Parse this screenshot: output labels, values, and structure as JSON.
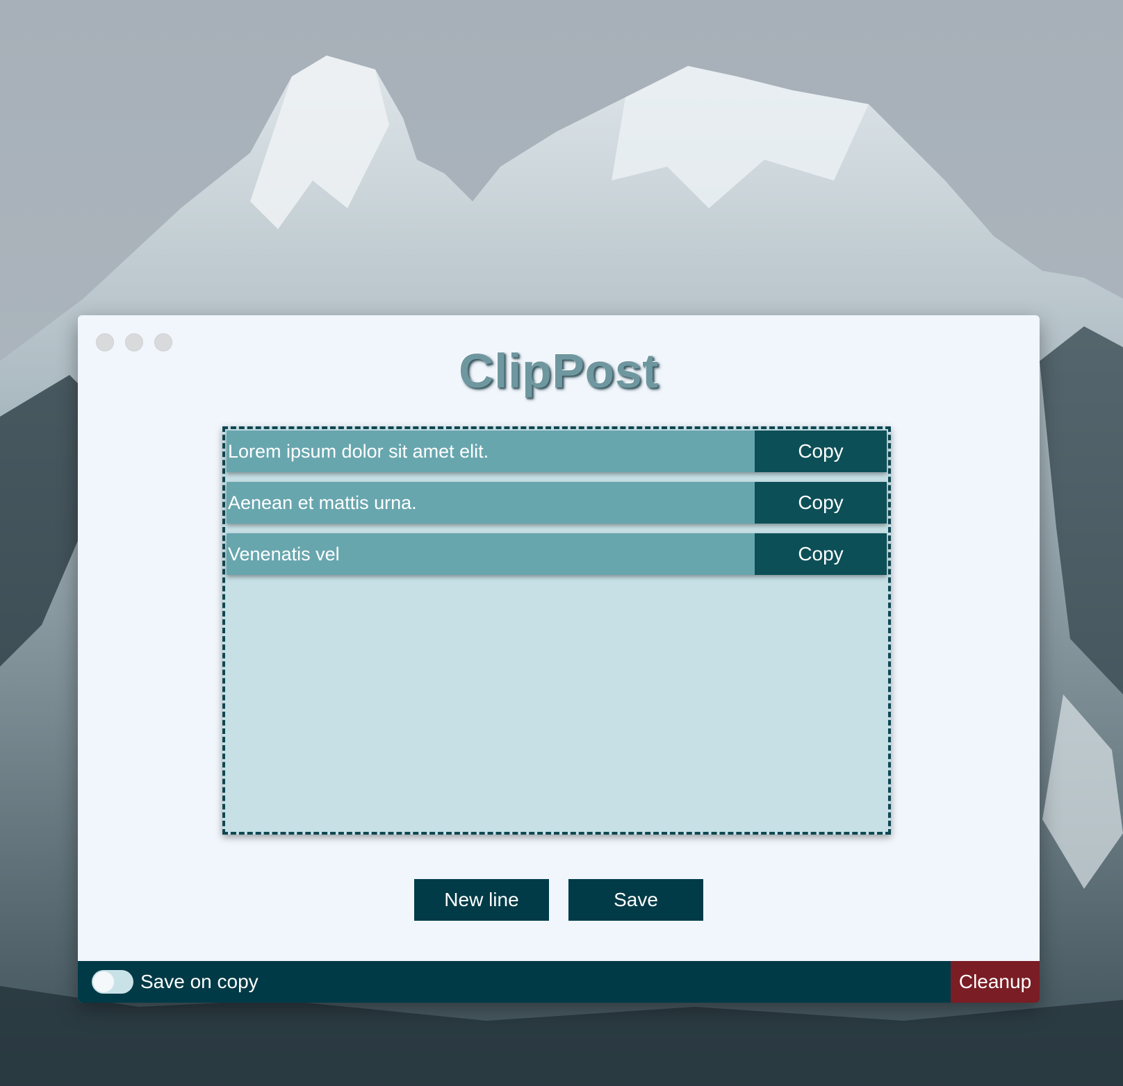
{
  "window": {
    "title": "ClipPost"
  },
  "clips": [
    {
      "text": "Lorem ipsum dolor sit amet elit.",
      "action": "Copy"
    },
    {
      "text": "Aenean et mattis urna.",
      "action": "Copy"
    },
    {
      "text": "Venenatis vel",
      "action": "Copy"
    }
  ],
  "actions": {
    "new_line": "New line",
    "save": "Save"
  },
  "footer": {
    "toggle_label": "Save on copy",
    "toggle_on": false,
    "cleanup": "Cleanup"
  },
  "colors": {
    "accent": "#003b47",
    "row": "#68a6ae",
    "copy_button": "#0d4f57",
    "clip_area": "#c6e0e6",
    "danger": "#7a1d24"
  }
}
